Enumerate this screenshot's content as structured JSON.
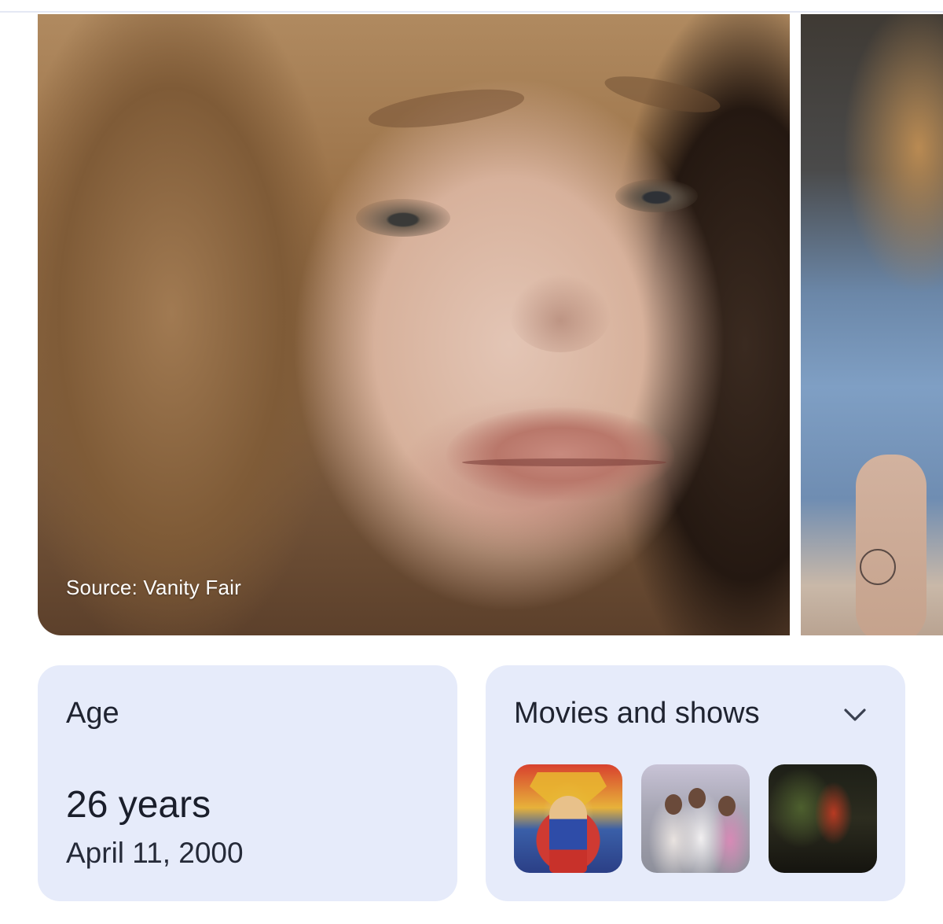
{
  "hero": {
    "source_caption": "Source: Vanity Fair"
  },
  "age_card": {
    "label": "Age",
    "value": "26 years",
    "birth_date": "April 11, 2000"
  },
  "movies_card": {
    "label": "Movies and shows",
    "toggle_icon": "chevron-down-icon",
    "thumbnails": [
      {
        "name": "movie-thumbnail-1"
      },
      {
        "name": "movie-thumbnail-2"
      },
      {
        "name": "movie-thumbnail-3"
      }
    ]
  },
  "colors": {
    "card_background": "#e6ebfa",
    "text_primary": "#1f2330"
  }
}
